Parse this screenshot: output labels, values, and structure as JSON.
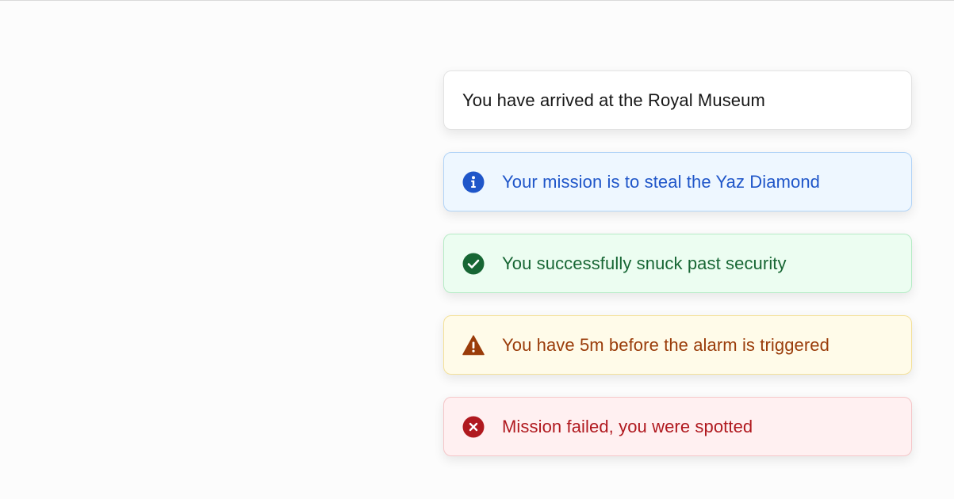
{
  "toasts": [
    {
      "type": "default",
      "message": "You have arrived at the Royal Museum",
      "icon": null
    },
    {
      "type": "info",
      "message": "Your mission is to steal the Yaz Diamond",
      "icon": "info-icon",
      "color": "#1f56c9"
    },
    {
      "type": "success",
      "message": "You successfully snuck past security",
      "icon": "check-circle-icon",
      "color": "#176634"
    },
    {
      "type": "warning",
      "message": "You have 5m before the alarm is triggered",
      "icon": "warning-triangle-icon",
      "color": "#9a3c0a"
    },
    {
      "type": "error",
      "message": "Mission failed, you were spotted",
      "icon": "x-circle-icon",
      "color": "#b0191f"
    }
  ]
}
